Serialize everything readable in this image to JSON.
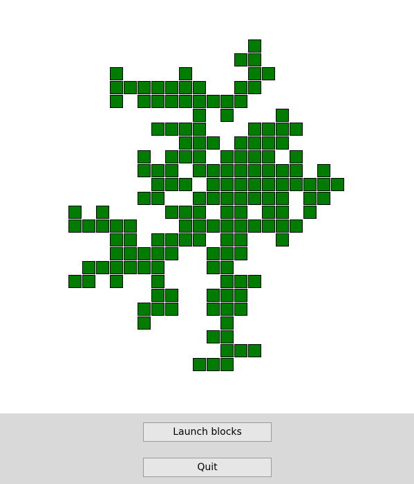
{
  "block_color": "#007c00",
  "buttons": {
    "launch_label": "Launch blocks",
    "quit_label": "Quit"
  },
  "grid": {
    "rows": [
      {
        "r": 0,
        "cols": [
          13
        ]
      },
      {
        "r": 1,
        "cols": [
          12,
          13
        ]
      },
      {
        "r": 2,
        "cols": [
          3,
          8,
          13,
          14
        ]
      },
      {
        "r": 3,
        "cols": [
          3,
          4,
          5,
          6,
          7,
          8,
          9,
          12,
          13
        ]
      },
      {
        "r": 4,
        "cols": [
          3,
          5,
          6,
          7,
          8,
          9,
          10,
          11,
          12
        ]
      },
      {
        "r": 5,
        "cols": [
          9,
          11,
          15
        ]
      },
      {
        "r": 6,
        "cols": [
          6,
          7,
          8,
          9,
          13,
          14,
          15,
          16
        ]
      },
      {
        "r": 7,
        "cols": [
          8,
          9,
          10,
          12,
          13,
          14,
          15
        ]
      },
      {
        "r": 8,
        "cols": [
          5,
          7,
          8,
          9,
          11,
          12,
          13,
          14,
          16
        ]
      },
      {
        "r": 9,
        "cols": [
          5,
          6,
          7,
          9,
          10,
          11,
          12,
          13,
          14,
          15,
          16,
          18
        ]
      },
      {
        "r": 10,
        "cols": [
          6,
          7,
          8,
          10,
          11,
          12,
          13,
          14,
          15,
          16,
          17,
          18,
          19
        ]
      },
      {
        "r": 11,
        "cols": [
          5,
          6,
          9,
          10,
          11,
          12,
          13,
          14,
          15,
          17,
          18
        ]
      },
      {
        "r": 12,
        "cols": [
          0,
          2,
          7,
          8,
          9,
          11,
          12,
          14,
          15,
          17
        ]
      },
      {
        "r": 13,
        "cols": [
          0,
          1,
          2,
          3,
          4,
          8,
          9,
          10,
          11,
          12,
          13,
          14,
          15,
          16
        ]
      },
      {
        "r": 14,
        "cols": [
          3,
          4,
          6,
          7,
          8,
          9,
          11,
          12,
          15
        ]
      },
      {
        "r": 15,
        "cols": [
          3,
          4,
          5,
          6,
          7,
          10,
          11,
          12
        ]
      },
      {
        "r": 16,
        "cols": [
          1,
          2,
          3,
          4,
          5,
          6,
          10,
          11
        ]
      },
      {
        "r": 17,
        "cols": [
          0,
          1,
          3,
          6,
          11,
          12,
          13
        ]
      },
      {
        "r": 18,
        "cols": [
          6,
          7,
          10,
          11,
          12
        ]
      },
      {
        "r": 19,
        "cols": [
          5,
          6,
          7,
          10,
          11,
          12
        ]
      },
      {
        "r": 20,
        "cols": [
          5,
          11
        ]
      },
      {
        "r": 21,
        "cols": [
          10,
          11
        ]
      },
      {
        "r": 22,
        "cols": [
          11,
          12,
          13
        ]
      },
      {
        "r": 23,
        "cols": [
          9,
          10,
          11
        ]
      }
    ]
  }
}
